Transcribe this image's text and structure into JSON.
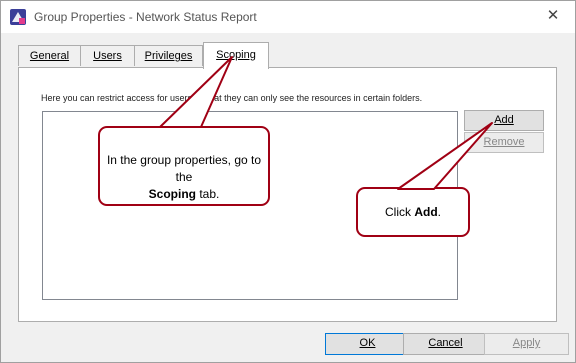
{
  "window": {
    "title": "Group Properties - Network Status Report"
  },
  "tabs": [
    {
      "label": "General",
      "active": false
    },
    {
      "label": "Users",
      "active": false
    },
    {
      "label": "Privileges",
      "active": false
    },
    {
      "label": "Scoping",
      "active": true
    }
  ],
  "scoping": {
    "hint": "Here you can restrict access for users so that they can only see the resources in certain folders.",
    "add_label": "Add",
    "remove_label": "Remove"
  },
  "callouts": {
    "tab_prefix": "In the group properties, go to the",
    "tab_bold": "Scoping",
    "tab_suffix": "tab.",
    "add_prefix": "Click",
    "add_bold": "Add",
    "add_suffix": "."
  },
  "footer": {
    "ok_label": "OK",
    "cancel_label": "Cancel",
    "apply_label": "Apply"
  },
  "colors": {
    "callout_border": "#a00014",
    "focus_border": "#0078d7"
  }
}
